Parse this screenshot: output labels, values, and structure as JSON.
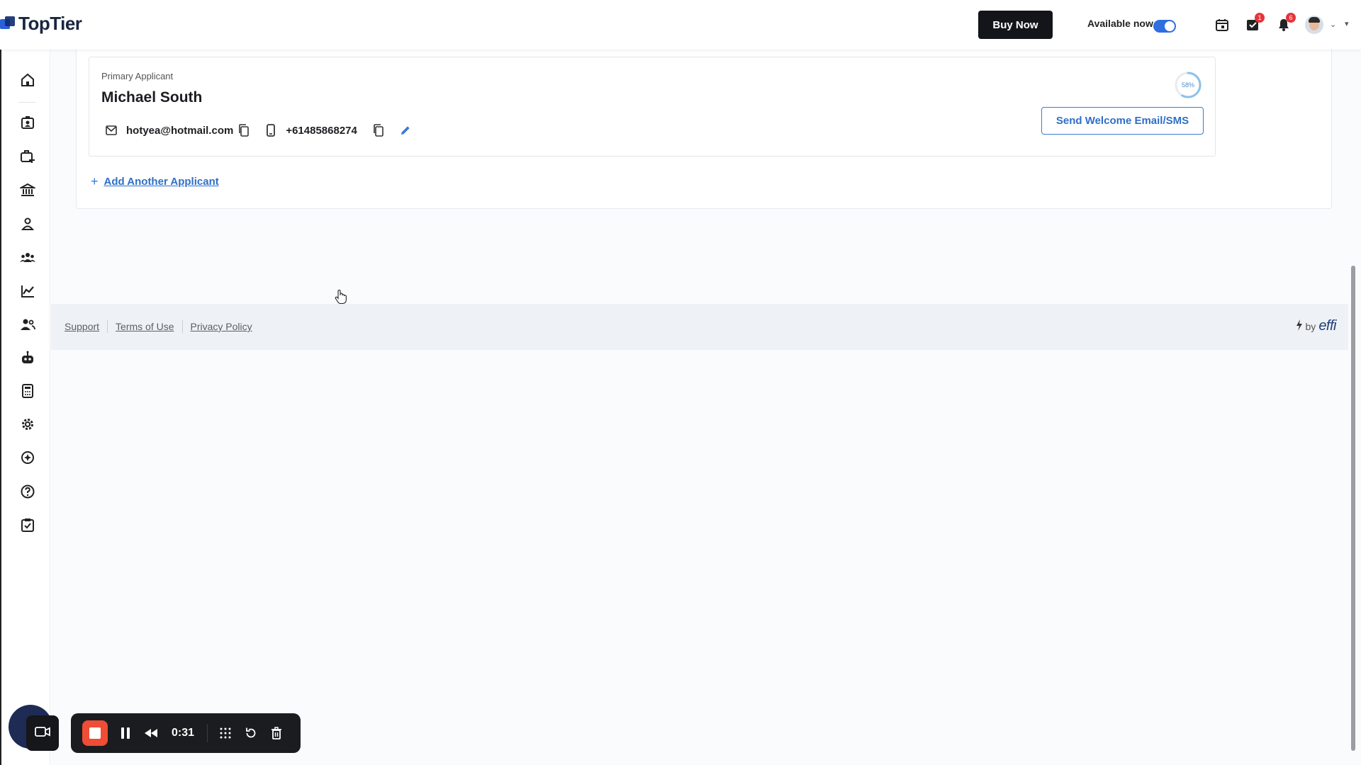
{
  "header": {
    "logo_text": "TopTier",
    "buy_now_label": "Buy Now",
    "availability_label": "Available now",
    "availability_on": true,
    "tasks_badge": "1",
    "notifications_badge": "6"
  },
  "sidebar": {
    "items": [
      {
        "name": "home-icon"
      },
      {
        "name": "contacts-icon"
      },
      {
        "name": "add-deal-icon"
      },
      {
        "name": "bank-icon"
      },
      {
        "name": "person-icon"
      },
      {
        "name": "team-icon"
      },
      {
        "name": "reports-icon"
      },
      {
        "name": "users-icon"
      },
      {
        "name": "robot-icon"
      },
      {
        "name": "calculator-icon"
      },
      {
        "name": "settings-icon"
      },
      {
        "name": "ai-icon"
      },
      {
        "name": "help-icon"
      },
      {
        "name": "checklist-icon"
      }
    ]
  },
  "applicant": {
    "role_label": "Primary Applicant",
    "name": "Michael South",
    "email": "hotyea@hotmail.com",
    "phone": "+61485868274",
    "progress_label": "58%",
    "progress_value": 0.58,
    "welcome_button_label": "Send Welcome Email/SMS"
  },
  "add_applicant_label": "Add Another Applicant",
  "footer": {
    "links": [
      "Support",
      "Terms of Use",
      "Privacy Policy"
    ],
    "powered_by_label": "by",
    "powered_by_brand": "effi"
  },
  "recorder": {
    "timer": "0:31"
  },
  "colors": {
    "accent": "#2f6fc6",
    "toggle": "#2f6fdf",
    "stop": "#ef4d35",
    "badge": "#e4353b"
  }
}
